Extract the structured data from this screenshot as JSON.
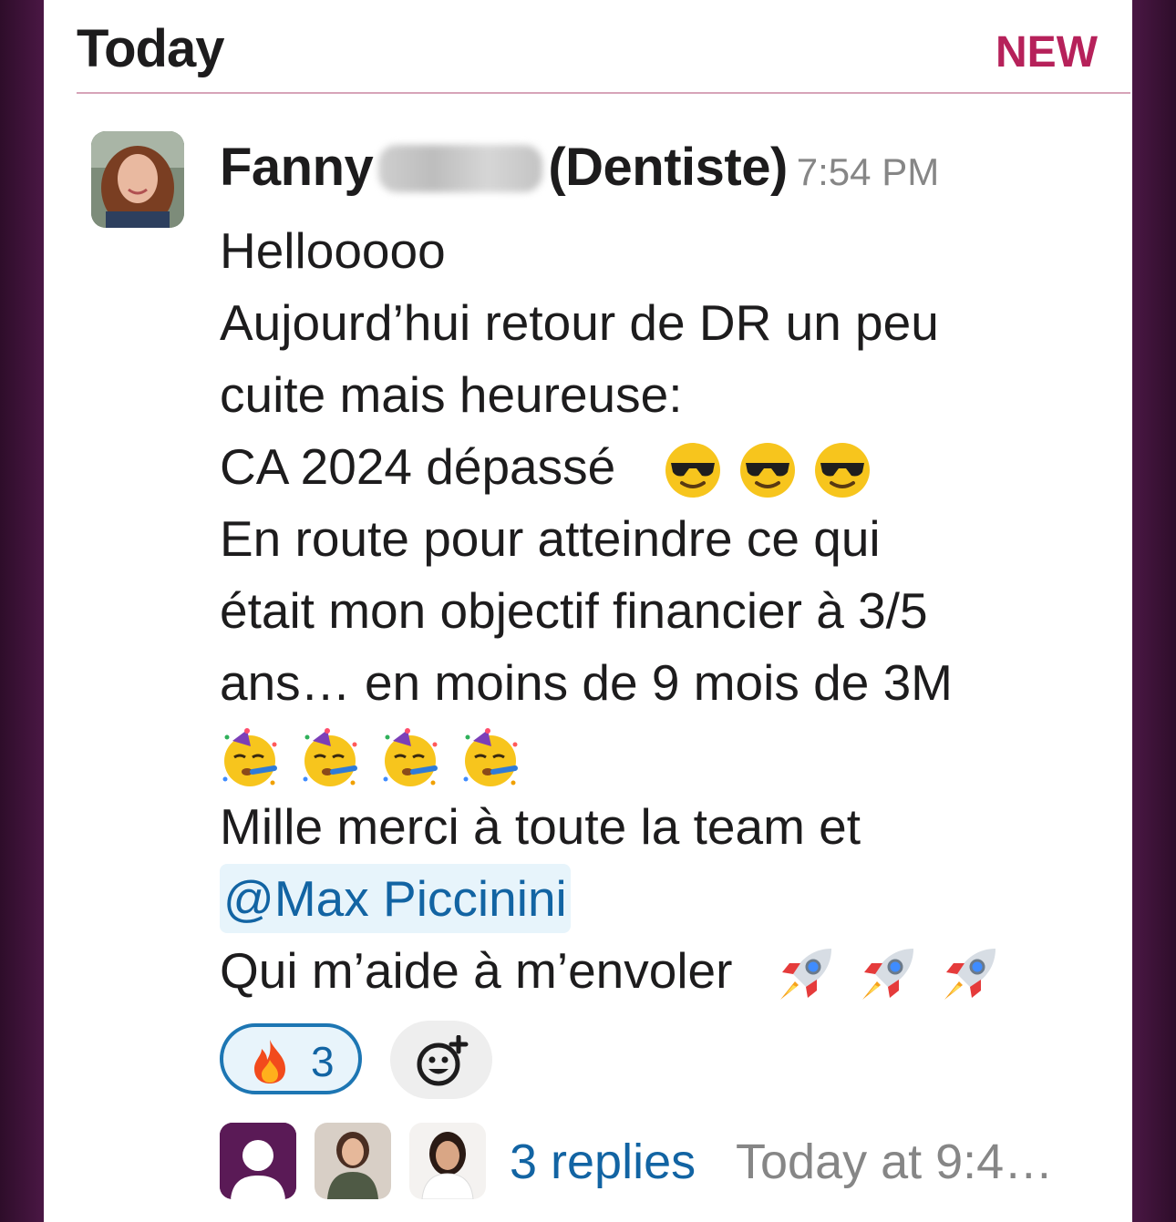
{
  "header": {
    "day_label": "Today",
    "new_label": "NEW"
  },
  "message": {
    "sender_first": "Fanny",
    "sender_suffix": "(Dentiste)",
    "time": "7:54 PM",
    "lines": {
      "l1": "Hellooooo",
      "l2": "Aujourd’hui retour de DR un peu",
      "l3": "cuite mais heureuse:",
      "l4": "CA 2024 dépassé",
      "l5": "En route pour atteindre ce qui",
      "l6": "était mon objectif financier à 3/5",
      "l7": "ans… en moins de 9 mois de 3M",
      "l9": "Mille merci à toute la team et",
      "mention": "@Max Piccinini",
      "l11": "Qui m’aide à m’envoler"
    },
    "emoji_names": [
      "sunglasses-emoji",
      "partying-face-emoji",
      "rocket-emoji"
    ]
  },
  "reactions": {
    "fire_count": "3",
    "fire_icon": "fire-emoji",
    "add_icon": "add-reaction-icon"
  },
  "thread": {
    "replies_label": "3 replies",
    "last_reply": "Today at 9:4…"
  },
  "colors": {
    "accent": "#b6215a",
    "link": "#1264a3",
    "sidebar": "#3b1136"
  }
}
